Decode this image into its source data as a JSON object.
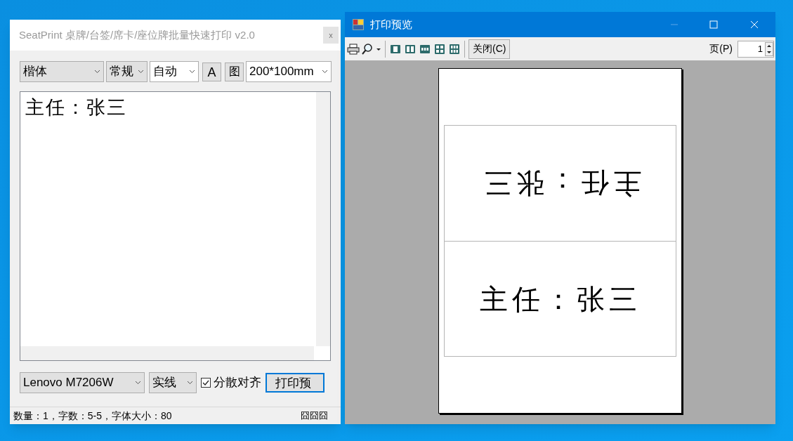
{
  "main_window": {
    "title": "SeatPrint 桌牌/台签/席卡/座位牌批量快速打印 v2.0",
    "close": "x",
    "toolbar": {
      "font": "楷体",
      "style": "常规",
      "size": "自动",
      "font_button": "A",
      "image_button": "图",
      "paper": "200*100mm"
    },
    "editor": {
      "value": "主任：张三"
    },
    "printer": "Lenovo M7206W",
    "line_style": "实线",
    "distribute": {
      "label": "分散对齐",
      "checked": true
    },
    "preview_button": "打印预",
    "status_bar": {
      "text": "数量：1，字数：5-5，字体大小：80",
      "right": "囧囧囧"
    }
  },
  "preview_window": {
    "title": "打印预览",
    "close_button": "关闭(C)",
    "page_label": "页(P)",
    "page_value": "1",
    "card_halves": [
      {
        "text": "主任：张三",
        "flipped": true
      },
      {
        "text": "主任：张三",
        "flipped": false
      }
    ]
  }
}
